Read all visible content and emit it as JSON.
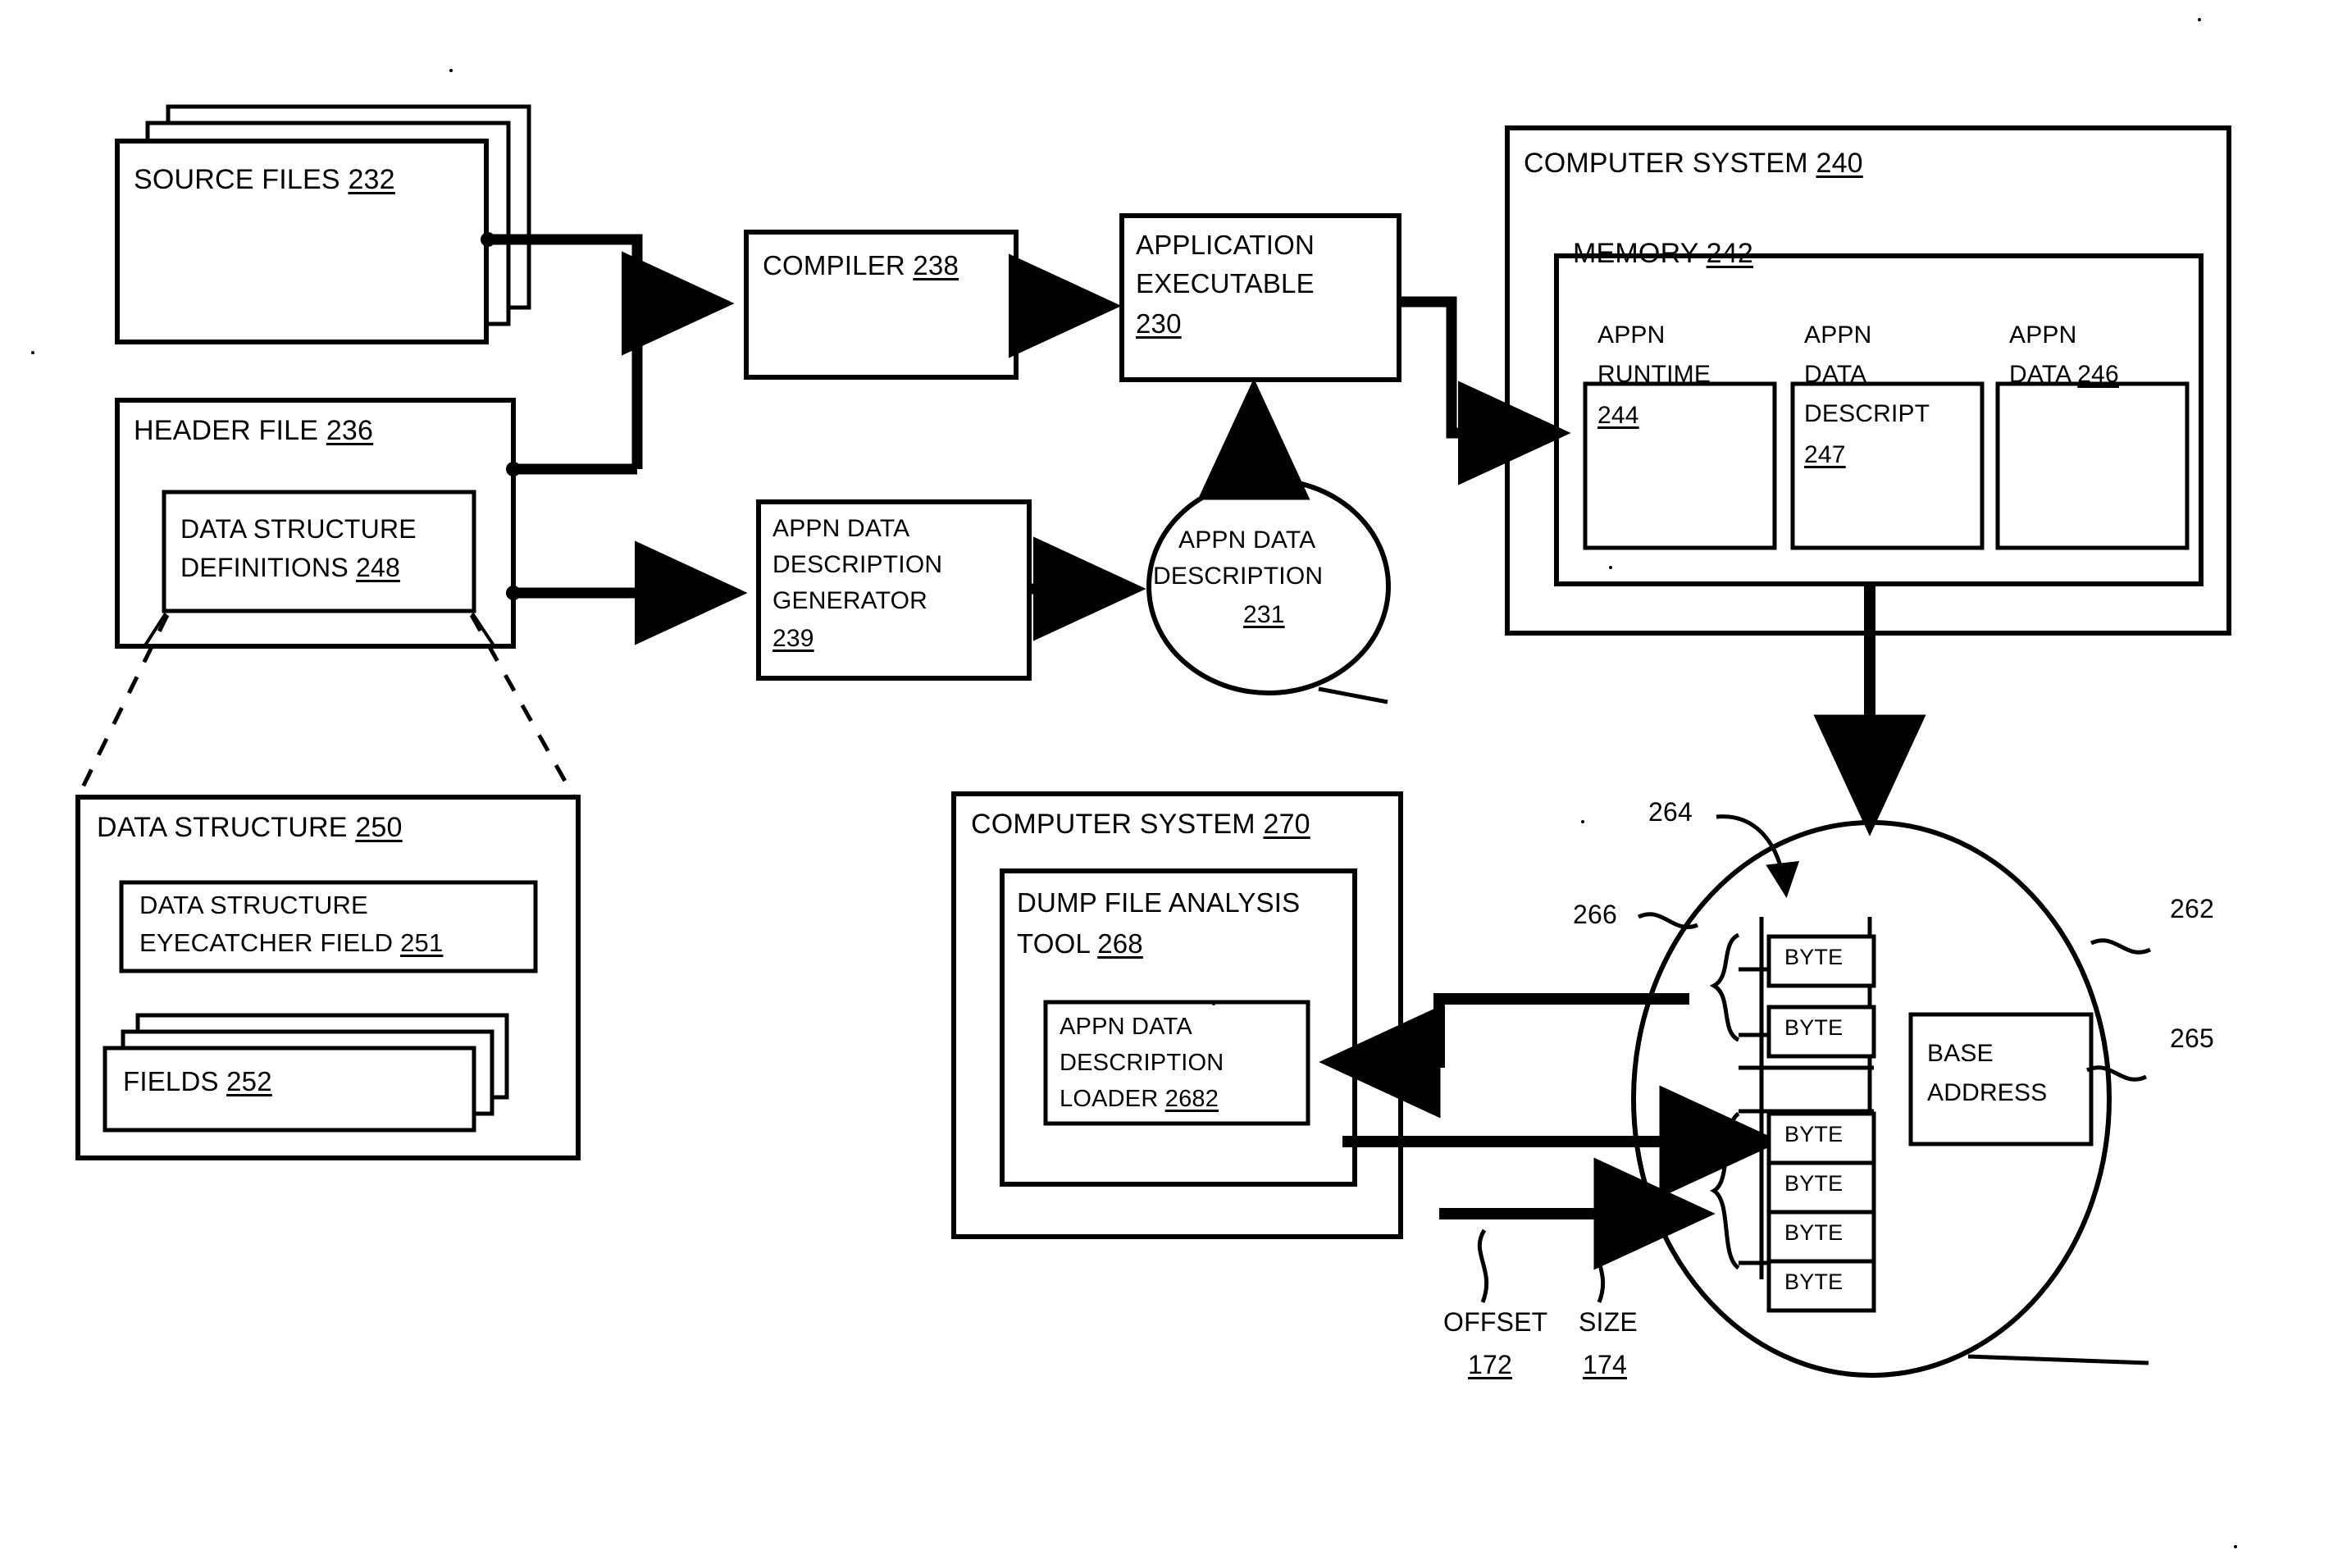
{
  "figure": {
    "kind": "patent-block-diagram",
    "stroke_color": "#000000",
    "background_color": "#ffffff"
  },
  "blocks": {
    "source_files": {
      "title": "SOURCE FILES",
      "ref": "232"
    },
    "header_file": {
      "title": "HEADER FILE",
      "ref": "236"
    },
    "data_structure_definitions": {
      "line1": "DATA STRUCTURE",
      "line2": "DEFINITIONS",
      "ref": "248"
    },
    "compiler": {
      "title": "COMPILER",
      "ref": "238"
    },
    "application_executable": {
      "line1": "APPLICATION",
      "line2": "EXECUTABLE",
      "ref": "230"
    },
    "appn_data_description_generator": {
      "line1": "APPN DATA",
      "line2": "DESCRIPTION",
      "line3": "GENERATOR",
      "ref": "239"
    },
    "appn_data_description": {
      "line1": "APPN DATA",
      "line2": "DESCRIPTION",
      "ref": "231"
    },
    "computer_system_240": {
      "title": "COMPUTER SYSTEM",
      "ref": "240"
    },
    "memory_242": {
      "title": "MEMORY",
      "ref": "242"
    },
    "appn_runtime": {
      "line1": "APPN",
      "line2": "RUNTIME",
      "ref": "244"
    },
    "appn_data_descript": {
      "line1": "APPN",
      "line2": "DATA",
      "line3": "DESCRIPT",
      "ref": "247"
    },
    "appn_data_246": {
      "line1": "APPN",
      "line2": "DATA",
      "ref": "246"
    },
    "data_structure_250": {
      "title": "DATA STRUCTURE",
      "ref": "250"
    },
    "data_structure_eyecatcher_field": {
      "line1": "DATA STRUCTURE",
      "line2": "EYECATCHER FIELD",
      "ref": "251"
    },
    "fields": {
      "title": "FIELDS",
      "ref": "252"
    },
    "computer_system_270": {
      "title": "COMPUTER SYSTEM",
      "ref": "270"
    },
    "dump_file_analysis_tool": {
      "line1": "DUMP FILE ANALYSIS",
      "line2": "TOOL",
      "ref": "268"
    },
    "appn_data_description_loader": {
      "line1": "APPN DATA",
      "line2": "DESCRIPTION",
      "line3": "LOADER",
      "ref": "2682"
    },
    "base_address": {
      "line1": "BASE",
      "line2": "ADDRESS"
    }
  },
  "byte_cells": [
    {
      "label": "BYTE",
      "group": "upper"
    },
    {
      "label": "BYTE",
      "group": "upper"
    },
    {
      "label": "BYTE",
      "group": "lower"
    },
    {
      "label": "BYTE",
      "group": "lower"
    },
    {
      "label": "BYTE",
      "group": "lower"
    },
    {
      "label": "BYTE",
      "group": "lower"
    }
  ],
  "callouts": {
    "ref_264": "264",
    "ref_266": "266",
    "ref_262": "262",
    "ref_265": "265",
    "offset_label": "OFFSET",
    "offset_ref": "172",
    "size_label": "SIZE",
    "size_ref": "174"
  }
}
